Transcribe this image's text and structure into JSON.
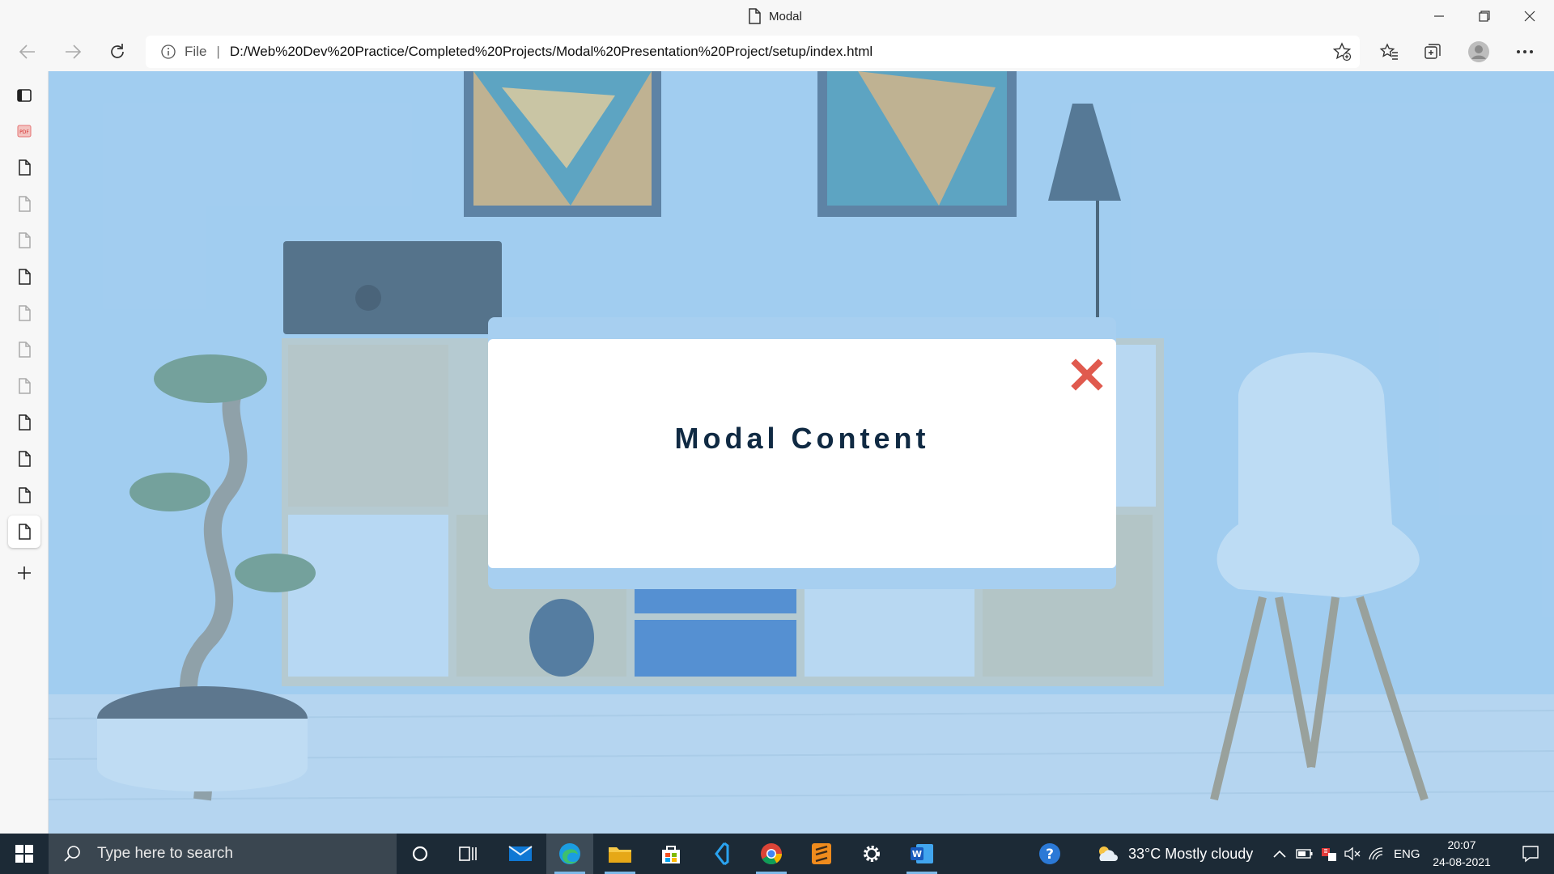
{
  "window": {
    "title": "Modal"
  },
  "address_bar": {
    "info_label": "File",
    "url": "D:/Web%20Dev%20Practice/Completed%20Projects/Modal%20Presentation%20Project/setup/index.html"
  },
  "sidebar": {
    "tab_count": 13,
    "active_index": 12
  },
  "modal": {
    "title": "Modal Content",
    "close_color": "#e05a4e",
    "title_color": "#102a43"
  },
  "taskbar": {
    "search_placeholder": "Type here to search",
    "weather": "33°C  Mostly cloudy",
    "language": "ENG",
    "time": "20:07",
    "date": "24-08-2021"
  },
  "icons": [
    "document-icon",
    "back-icon",
    "forward-icon",
    "refresh-icon",
    "info-icon",
    "add-favorite-icon",
    "favorites-icon",
    "collections-icon",
    "profile-icon",
    "more-icon",
    "tab-actions-icon",
    "new-tab-icon",
    "close-icon",
    "windows-start-icon",
    "search-icon",
    "cortana-icon",
    "task-view-icon",
    "mail-icon",
    "edge-icon",
    "file-explorer-icon",
    "store-icon",
    "vscode-icon",
    "chrome-icon",
    "sublime-icon",
    "settings-icon",
    "word-icon",
    "help-icon",
    "weather-icon",
    "chevron-up-icon",
    "battery-icon",
    "network-icon",
    "volume-mute-icon",
    "wifi-icon",
    "notification-icon"
  ]
}
